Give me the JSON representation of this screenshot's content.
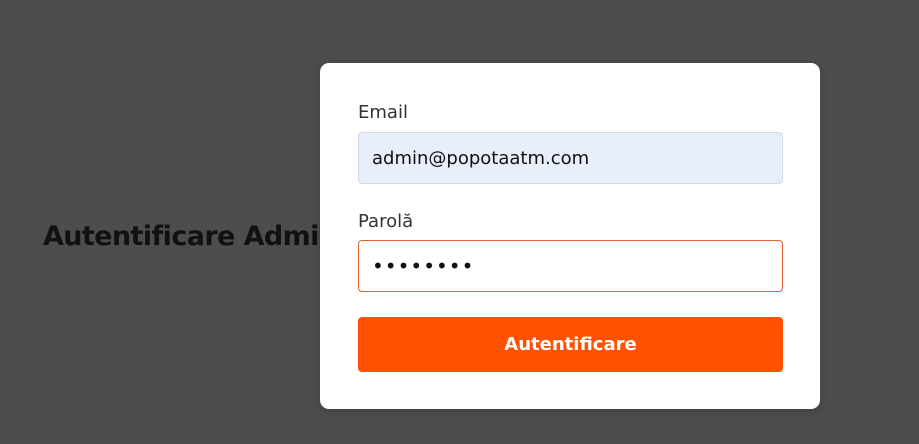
{
  "page": {
    "title": "Autentificare Admin"
  },
  "login_form": {
    "email": {
      "label": "Email",
      "value": "admin@popotaatm.com"
    },
    "password": {
      "label": "Parolă",
      "value": "********"
    },
    "submit_label": "Autentificare"
  },
  "colors": {
    "background": "#4d4d4d",
    "card": "#ffffff",
    "accent": "#ff5100",
    "email_input_fill": "#e8effb",
    "password_border": "#e0642a"
  }
}
